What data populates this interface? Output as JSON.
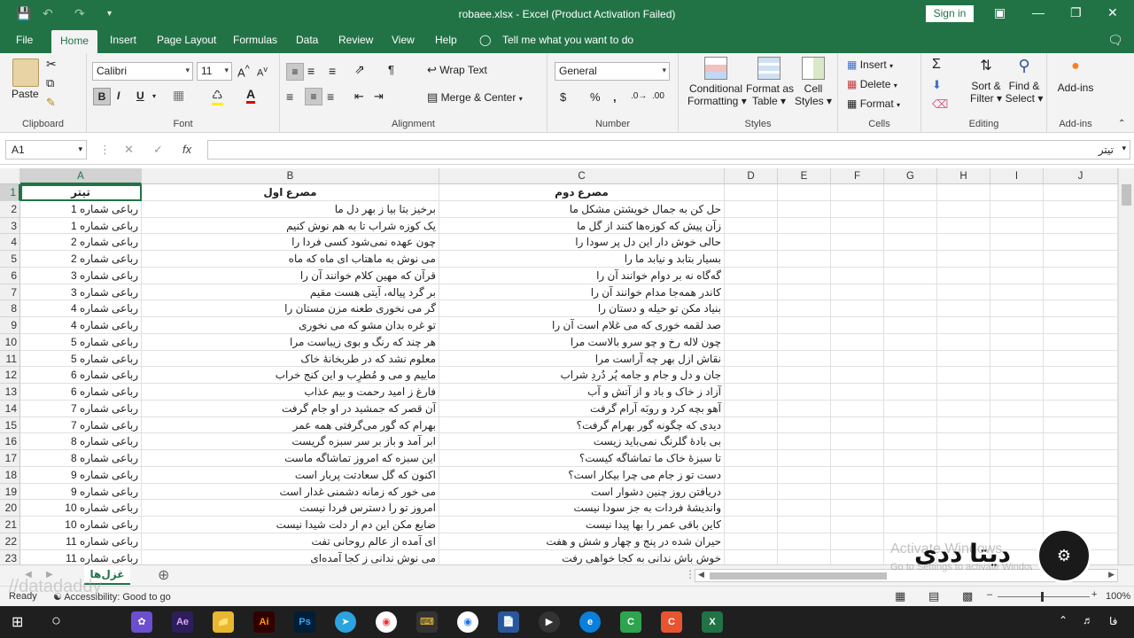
{
  "window": {
    "title": "robaee.xlsx - Excel (Product Activation Failed)",
    "signin": "Sign in"
  },
  "tabs": [
    {
      "label": "File"
    },
    {
      "label": "Home",
      "active": true
    },
    {
      "label": "Insert"
    },
    {
      "label": "Page Layout"
    },
    {
      "label": "Formulas"
    },
    {
      "label": "Data"
    },
    {
      "label": "Review"
    },
    {
      "label": "View"
    },
    {
      "label": "Help"
    },
    {
      "label": "Tell me what you want to do"
    }
  ],
  "ribbon": {
    "clipboard": {
      "label": "Clipboard",
      "paste": "Paste"
    },
    "font": {
      "label": "Font",
      "name": "Calibri",
      "size": "11",
      "bold": "B",
      "italic": "I",
      "underline": "U"
    },
    "alignment": {
      "label": "Alignment",
      "wrap": "Wrap Text",
      "merge": "Merge & Center"
    },
    "number": {
      "label": "Number",
      "format": "General"
    },
    "styles": {
      "label": "Styles",
      "cond1": "Conditional",
      "cond2": "Formatting",
      "fmt1": "Format as",
      "fmt2": "Table",
      "cell1": "Cell",
      "cell2": "Styles"
    },
    "cells": {
      "label": "Cells",
      "insert": "Insert",
      "delete": "Delete",
      "format": "Format"
    },
    "editing": {
      "label": "Editing",
      "sort1": "Sort &",
      "sort2": "Filter",
      "find1": "Find &",
      "find2": "Select"
    },
    "addins": {
      "label": "Add-ins",
      "btn": "Add-ins"
    }
  },
  "formula_bar": {
    "name_box": "A1",
    "fx": "fx",
    "content": "تیتر"
  },
  "columns": [
    "A",
    "B",
    "C",
    "D",
    "E",
    "F",
    "G",
    "H",
    "I",
    "J"
  ],
  "header_row": [
    "تیتر",
    "مصرع اول",
    "مصرع دوم"
  ],
  "rows": [
    [
      "رباعی شماره 1",
      "برخیز بتا بیا ز بهر دل ما",
      "حل کن به جمال خویشتن مشکل ما"
    ],
    [
      "رباعی شماره 1",
      "یک کوزه شراب تا به هم نوش کنیم",
      "زآن پیش که کوزه‌ها کنند از گل ما"
    ],
    [
      "رباعی شماره 2",
      "چون عهده نمی‌شود کسی فردا را",
      "حالی خوش دار این دل پر سودا را"
    ],
    [
      "رباعی شماره 2",
      "می نوش به ماهتاب ای ماه که ماه",
      "بسیار بتابد و نیابد ما را"
    ],
    [
      "رباعی شماره 3",
      "قرآن که مهین کلام خوانند آن را",
      "گه‌گاه نه بر دوام خوانند آن را"
    ],
    [
      "رباعی شماره 3",
      "بر گرد پیاله، آیتی هست مقیم",
      "کاندر همه‌جا مدام خوانند آن را"
    ],
    [
      "رباعی شماره 4",
      "گر می نخوری طعنه مزن مستان را",
      "بنیاد مکن تو حیله و دستان را"
    ],
    [
      "رباعی شماره 4",
      "تو غره بدان مشو که می نخوری",
      "صد لقمه خوری که می غلام است آن را"
    ],
    [
      "رباعی شماره 5",
      "هر چند که رنگ و بوی زیباست مرا",
      "چون لاله رخ و چو سرو بالاست مرا"
    ],
    [
      "رباعی شماره 5",
      "معلوم نشد که در طربخانهٔ خاک",
      "نقاش ازل بهر چه آراست مرا"
    ],
    [
      "رباعی شماره 6",
      "ماییم و می و مُطرِب و این کنج خراب",
      "جان و دل و جام و جامه پُر دُردِ شراب"
    ],
    [
      "رباعی شماره 6",
      "فارغ ز امید رحمت و بیم عذاب",
      "آزاد ز خاک و باد و از آتش و آب"
    ],
    [
      "رباعی شماره 7",
      "آن قصر که جمشید در او جام گرفت",
      "آهو بچه کرد و روبَه آرام گرفت"
    ],
    [
      "رباعی شماره 7",
      "بهرام که گور می‌گرفتی همه عمر",
      "دیدی که چگونه گور بهرام گرفت؟"
    ],
    [
      "رباعی شماره 8",
      "ابر آمد و باز بر سر سبزه گریست",
      "بی بادهٔ گلرنگ نمی‌باید زیست"
    ],
    [
      "رباعی شماره 8",
      "این سبزه که امروز تماشاگه ماست",
      "تا سبزهٔ خاک ما تماشاگه کیست؟"
    ],
    [
      "رباعی شماره 9",
      "اکنون که گل سعادتت پربار است",
      "دست تو ز جام می چرا بیکار است؟"
    ],
    [
      "رباعی شماره 9",
      "می خور که زمانه دشمنی غدار است",
      "دریافتن روز چنین دشوار است"
    ],
    [
      "رباعی شماره 10",
      "امروز تو را دسترس فردا نیست",
      "واندیشهٔ فردات به جز سودا نیست"
    ],
    [
      "رباعی شماره 10",
      "ضایع مکن این دم ار دلت شیدا نیست",
      "کاین باقی عمر را بها پیدا نیست"
    ],
    [
      "رباعی شماره 11",
      "ای آمده از عالم روحانی تفت",
      "حیران شده در پنج و چهار و شش و هفت"
    ],
    [
      "رباعی شماره 11",
      "می نوش ندانی ز کجا آمده‌ای",
      "خوش باش ندانی به کجا خواهی رفت"
    ]
  ],
  "sheet_tab": "غزل‌ها",
  "status": {
    "ready": "Ready",
    "accessibility": "Accessibility: Good to go",
    "zoom": "100%"
  },
  "watermark": {
    "activate1": "Activate Windows",
    "activate2": "Go to Settings to activate Windows.",
    "logo": "دیتا ددی",
    "url": "//datadaddy"
  },
  "taskbar": {
    "lang": "فا"
  }
}
